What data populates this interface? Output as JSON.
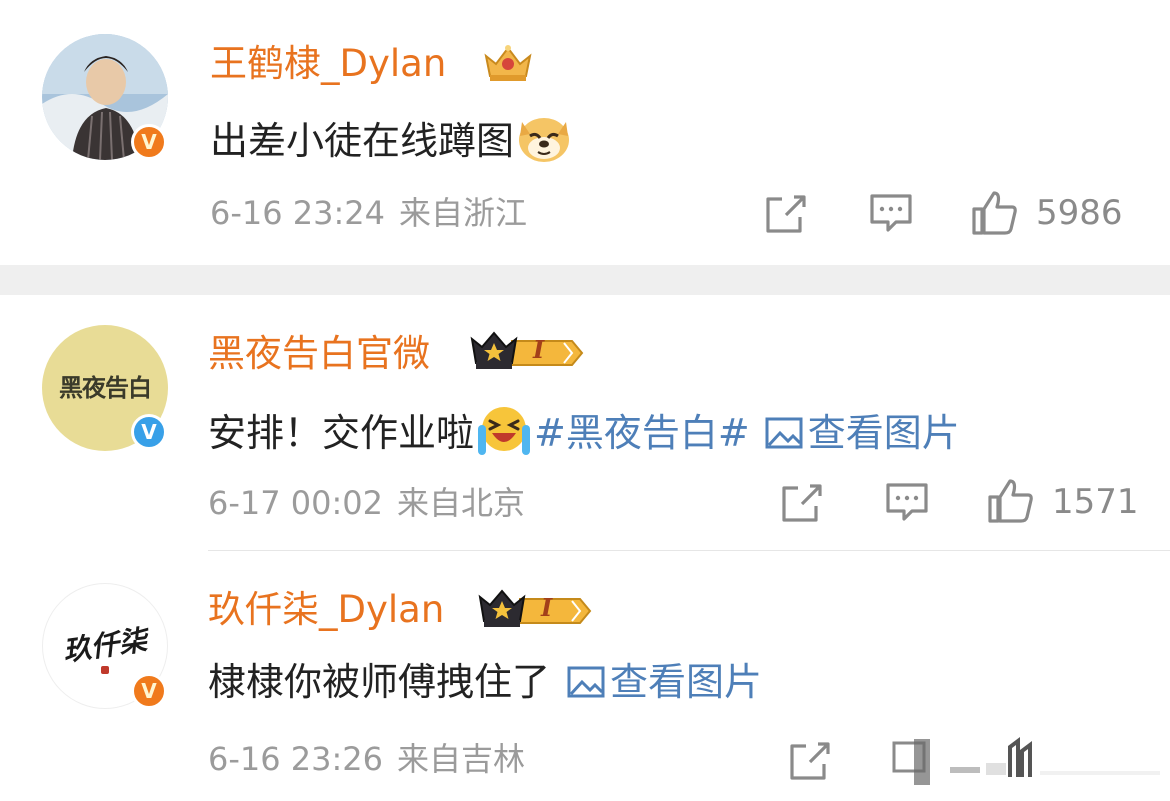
{
  "comments": [
    {
      "username": "王鹤棣_Dylan",
      "verified": "V",
      "text": "出差小徒在线蹲图",
      "emoji": "doge-emoji",
      "date": "6-16 23:24",
      "location": "来自浙江",
      "likes": "5986"
    },
    {
      "username": "黑夜告白官微",
      "avatar_text": "黑夜告白",
      "verified": "V",
      "level_text": "I",
      "text": "安排！交作业啦",
      "emoji": "laugh-cry-emoji",
      "topic": "#黑夜告白#",
      "view_image": "查看图片",
      "date": "6-17 00:02",
      "location": "来自北京",
      "likes": "1571"
    },
    {
      "username": "玖仟柒_Dylan",
      "avatar_text": "玖仟柒",
      "verified": "V",
      "level_text": "I",
      "text": "棣棣你被师傅拽住了",
      "view_image": "查看图片",
      "date": "6-16 23:26",
      "location": "来自吉林"
    }
  ],
  "colors": {
    "username": "#e8731f",
    "link": "#4e7fb8",
    "meta": "#9b9b9b",
    "badge_orange": "#f07a1c",
    "badge_blue": "#38a0e8"
  }
}
